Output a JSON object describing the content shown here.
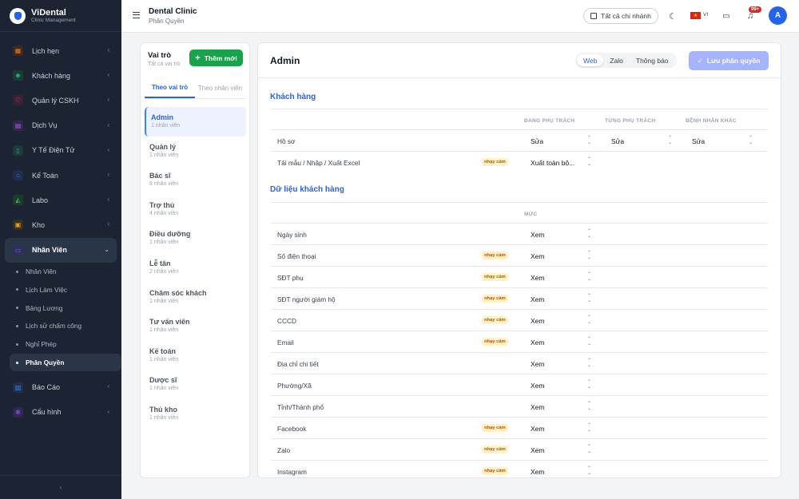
{
  "sidebar": {
    "brand_name": "ViDental",
    "brand_sub": "Clinic Management",
    "items": [
      {
        "label": "Lịch hẹn",
        "icon": "calendar-icon",
        "color": "#f97316"
      },
      {
        "label": "Khách hàng",
        "icon": "users-icon",
        "color": "#10b981"
      },
      {
        "label": "Quản lý CSKH",
        "icon": "heart-icon",
        "color": "#ec4899"
      },
      {
        "label": "Dịch Vụ",
        "icon": "service-icon",
        "color": "#a855f7"
      },
      {
        "label": "Y Tế Điện Tử",
        "icon": "medical-record-icon",
        "color": "#14b8a6"
      },
      {
        "label": "Kế Toán",
        "icon": "accounting-icon",
        "color": "#3b82f6"
      },
      {
        "label": "Labo",
        "icon": "labo-icon",
        "color": "#22c55e"
      },
      {
        "label": "Kho",
        "icon": "warehouse-icon",
        "color": "#f59e0b"
      },
      {
        "label": "Nhân Viên",
        "icon": "briefcase-icon",
        "color": "#6366f1"
      }
    ],
    "sub_items": [
      "Nhân Viên",
      "Lịch Làm Việc",
      "Bảng Lương",
      "Lịch sử chấm công",
      "Nghỉ Phép",
      "Phân Quyền"
    ],
    "bottom_items": [
      {
        "label": "Báo Cáo",
        "icon": "chart-icon",
        "color": "#3b82f6"
      },
      {
        "label": "Cấu hình",
        "icon": "gear-icon",
        "color": "#8b5cf6"
      }
    ]
  },
  "header": {
    "clinic_name": "Dental Clinic",
    "page": "Phân Quyền",
    "branch": "Tất cả chi nhánh",
    "lang": "VI",
    "notif_count": "99+",
    "avatar": "A"
  },
  "roles": {
    "title": "Vai trò",
    "subtitle": "Tất cả vai trò",
    "add_label": "Thêm mới",
    "tab_role": "Theo vai trò",
    "tab_staff": "Theo nhân viên",
    "items": [
      {
        "name": "Admin",
        "count": "1 nhân viên"
      },
      {
        "name": "Quản lý",
        "count": "1 nhân viên"
      },
      {
        "name": "Bác sĩ",
        "count": "8 nhân viên"
      },
      {
        "name": "Trợ thủ",
        "count": "4 nhân viên"
      },
      {
        "name": "Điều dưỡng",
        "count": "1 nhân viên"
      },
      {
        "name": "Lễ tân",
        "count": "2 nhân viên"
      },
      {
        "name": "Chăm sóc khách",
        "count": "1 nhân viên"
      },
      {
        "name": "Tư vấn viên",
        "count": "1 nhân viên"
      },
      {
        "name": "Kế toán",
        "count": "1 nhân viên"
      },
      {
        "name": "Dược sĩ",
        "count": "1 nhân viên"
      },
      {
        "name": "Thủ kho",
        "count": "1 nhân viên"
      }
    ]
  },
  "main": {
    "title": "Admin",
    "seg": [
      "Web",
      "Zalo",
      "Thông báo"
    ],
    "save_label": "Lưu phân quyền",
    "sensitive_label": "nhạy cảm",
    "section1": {
      "title": "Khách hàng",
      "headers": [
        "ĐANG PHỤ TRÁCH",
        "TỪNG PHỤ TRÁCH",
        "BỆNH NHÂN KHÁC"
      ],
      "rows": [
        {
          "label": "Hồ sơ",
          "v1": "Sửa",
          "v2": "Sửa",
          "v3": "Sửa"
        },
        {
          "label": "Tải mẫu / Nhập / Xuất Excel",
          "v1": "Xuất toàn bộ..."
        }
      ]
    },
    "section2": {
      "title": "Dữ liệu khách hàng",
      "header": "MỨC",
      "rows": [
        {
          "label": "Ngày sinh",
          "v": "Xem"
        },
        {
          "label": "Số điện thoại",
          "v": "Xem"
        },
        {
          "label": "SĐT phụ",
          "v": "Xem"
        },
        {
          "label": "SĐT người giám hộ",
          "v": "Xem"
        },
        {
          "label": "CCCD",
          "v": "Xem"
        },
        {
          "label": "Email",
          "v": "Xem"
        },
        {
          "label": "Địa chỉ chi tiết",
          "v": "Xem"
        },
        {
          "label": "Phường/Xã",
          "v": "Xem"
        },
        {
          "label": "Tỉnh/Thành phố",
          "v": "Xem"
        },
        {
          "label": "Facebook",
          "v": "Xem"
        },
        {
          "label": "Zalo",
          "v": "Xem"
        },
        {
          "label": "Instagram",
          "v": "Xem"
        }
      ]
    }
  }
}
